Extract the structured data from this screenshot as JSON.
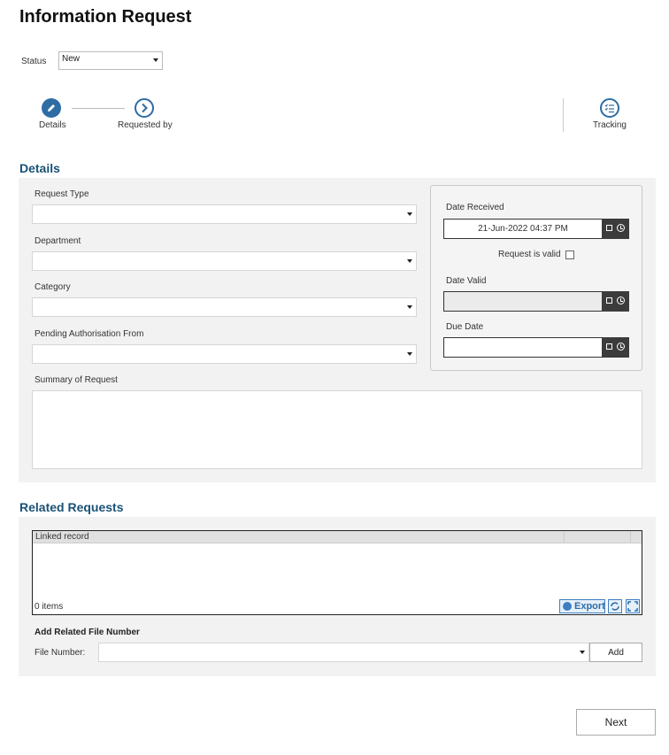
{
  "page": {
    "title": "Information Request"
  },
  "status": {
    "label": "Status",
    "value": "New"
  },
  "steps": [
    {
      "label": "Details"
    },
    {
      "label": "Requested by"
    },
    {
      "label": "Tracking"
    }
  ],
  "details": {
    "heading": "Details",
    "request_type_label": "Request Type",
    "department_label": "Department",
    "category_label": "Category",
    "pending_label": "Pending Authorisation From",
    "summary_label": "Summary of Request",
    "date_received_label": "Date Received",
    "date_received_value": "21-Jun-2022 04:37 PM",
    "request_valid_label": "Request is valid",
    "date_valid_label": "Date Valid",
    "due_date_label": "Due Date"
  },
  "related": {
    "heading": "Related Requests",
    "grid_column": "Linked record",
    "items_count": "0 items",
    "export_label": "Export",
    "add_heading": "Add Related File Number",
    "file_number_label": "File Number:",
    "add_button": "Add"
  },
  "footer": {
    "next_button": "Next"
  },
  "colors": {
    "accent": "#2e6da4",
    "section_heading": "#1a5276",
    "panel_bg": "#f2f2f2"
  }
}
